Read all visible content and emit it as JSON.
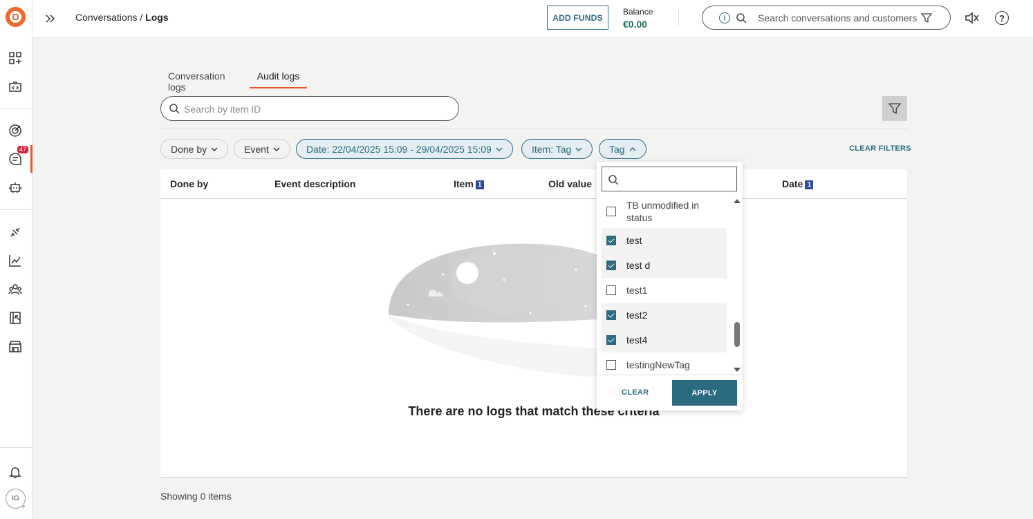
{
  "topbar": {
    "breadcrumb_parent": "Conversations /",
    "breadcrumb_current": "Logs",
    "add_funds": "ADD FUNDS",
    "balance_label": "Balance",
    "balance_value": "€0.00",
    "search_placeholder": "Search conversations and customers",
    "info_glyph": "i",
    "help_glyph": "?"
  },
  "sidebar": {
    "badge_count": "47",
    "avatar_initials": "IG",
    "icons": [
      "apps-icon",
      "code-icon",
      "target-icon",
      "conversations-icon",
      "bot-icon",
      "integrations-icon",
      "analytics-icon",
      "contacts-icon",
      "import-icon",
      "store-icon",
      "bell-icon"
    ]
  },
  "tabs": [
    {
      "label": "Conversation logs",
      "active": false
    },
    {
      "label": "Audit logs",
      "active": true
    }
  ],
  "item_search": {
    "placeholder": "Search by item ID"
  },
  "filters": {
    "chips": [
      {
        "label": "Done by",
        "active": false
      },
      {
        "label": "Event",
        "active": false
      },
      {
        "label": "Date: 22/04/2025 15:09 - 29/04/2025 15:09",
        "active": true
      },
      {
        "label": "Item: Tag",
        "active": true
      },
      {
        "label": "Tag",
        "active": true,
        "open": true
      }
    ],
    "clear_label": "CLEAR FILTERS"
  },
  "table": {
    "columns": [
      {
        "label": "Done by",
        "sort": ""
      },
      {
        "label": "Event description",
        "sort": ""
      },
      {
        "label": "Item",
        "sort": "1"
      },
      {
        "label": "Old value",
        "sort": ""
      },
      {
        "label": "Date",
        "sort": "1"
      }
    ],
    "empty_message": "There are no logs that match these criteria",
    "showing": "Showing 0 items"
  },
  "tag_dropdown": {
    "options": [
      {
        "label": "TB unmodified in status",
        "checked": false
      },
      {
        "label": "test",
        "checked": true
      },
      {
        "label": "test d",
        "checked": true
      },
      {
        "label": "test1",
        "checked": false
      },
      {
        "label": "test2",
        "checked": true
      },
      {
        "label": "test4",
        "checked": true
      },
      {
        "label": "testingNewTag",
        "checked": false
      }
    ],
    "clear_label": "CLEAR",
    "apply_label": "APPLY"
  },
  "colors": {
    "accent": "#2b6a80",
    "brand": "#ee6a2c",
    "badge": "#d0243b",
    "balance": "#1f6e63"
  }
}
